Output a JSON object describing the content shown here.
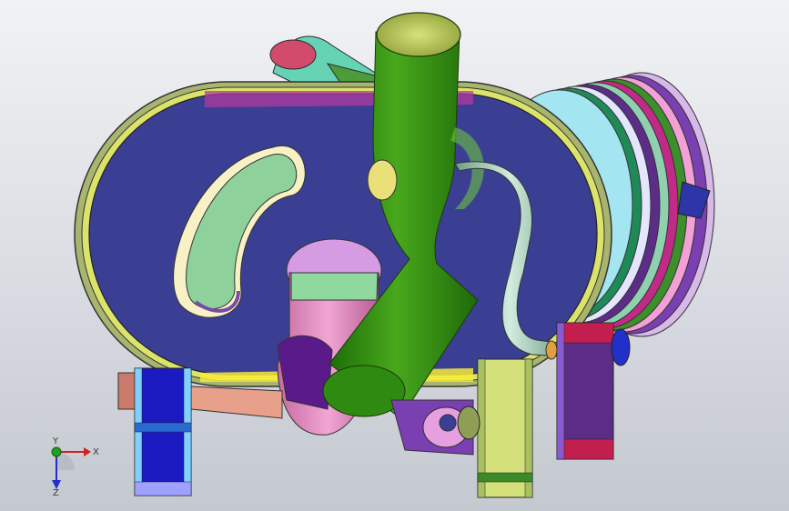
{
  "viewport": {
    "background_top": "#f1f2f4",
    "background_bottom": "#c4c8cf"
  },
  "model": {
    "description_icon": "cad-3d-model",
    "colors": {
      "plate_face": "#3b3f93",
      "rim_outer": "#8fa06a",
      "main_pipe": "#2f8a12",
      "bent_pipe": "#e58fc4",
      "coil_band": "#7a3fb0",
      "small_tube": "#9fc6b4"
    }
  },
  "triad": {
    "x_label": "X",
    "y_label": "Y",
    "z_label": "Z",
    "x_color": "#d42020",
    "y_color": "#1fa020",
    "z_color": "#2030c8"
  }
}
